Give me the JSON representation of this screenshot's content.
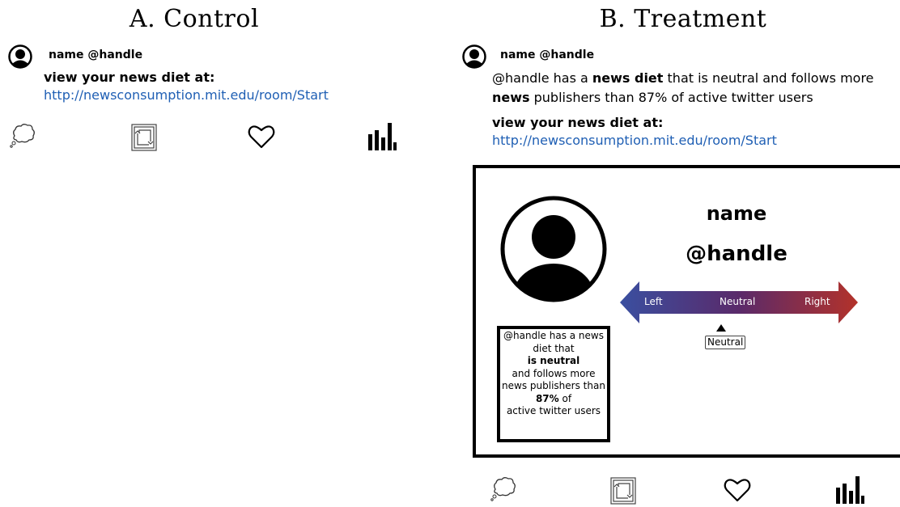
{
  "panel_a": {
    "title": "A. Control",
    "name_handle": "name @handle",
    "cta": "view your news diet at:",
    "link": "http://newsconsumption.mit.edu/room/Start"
  },
  "panel_b": {
    "title": "B. Treatment",
    "name_handle": "name @handle",
    "summary": {
      "handle": "@handle",
      "part1": " has a ",
      "bold1": "news diet",
      "part2": " that is neutral and follows more",
      "bold2": "news",
      "part3": " publishers than 87% of active twitter users"
    },
    "cta": "view your news diet at:",
    "link": "http://newsconsumption.mit.edu/room/Start",
    "card": {
      "name": "name",
      "handle": "@handle",
      "scale": {
        "left": "Left",
        "center": "Neutral",
        "right": "Right",
        "marker_label": "Neutral",
        "position": 0.5,
        "left_color": "#3a4fa0",
        "right_color": "#b3322a"
      },
      "diet_box": {
        "line1": "@handle has a news",
        "line2": "diet that",
        "line3": "is neutral",
        "line4": "and follows more",
        "line5": "news publishers than",
        "line6_bold": "87%",
        "line6_rest": " of",
        "line7": "active twitter users"
      }
    }
  },
  "icons": [
    "reply-icon",
    "retweet-icon",
    "like-icon",
    "analytics-icon"
  ],
  "colors": {
    "link": "#1f5fb4"
  }
}
